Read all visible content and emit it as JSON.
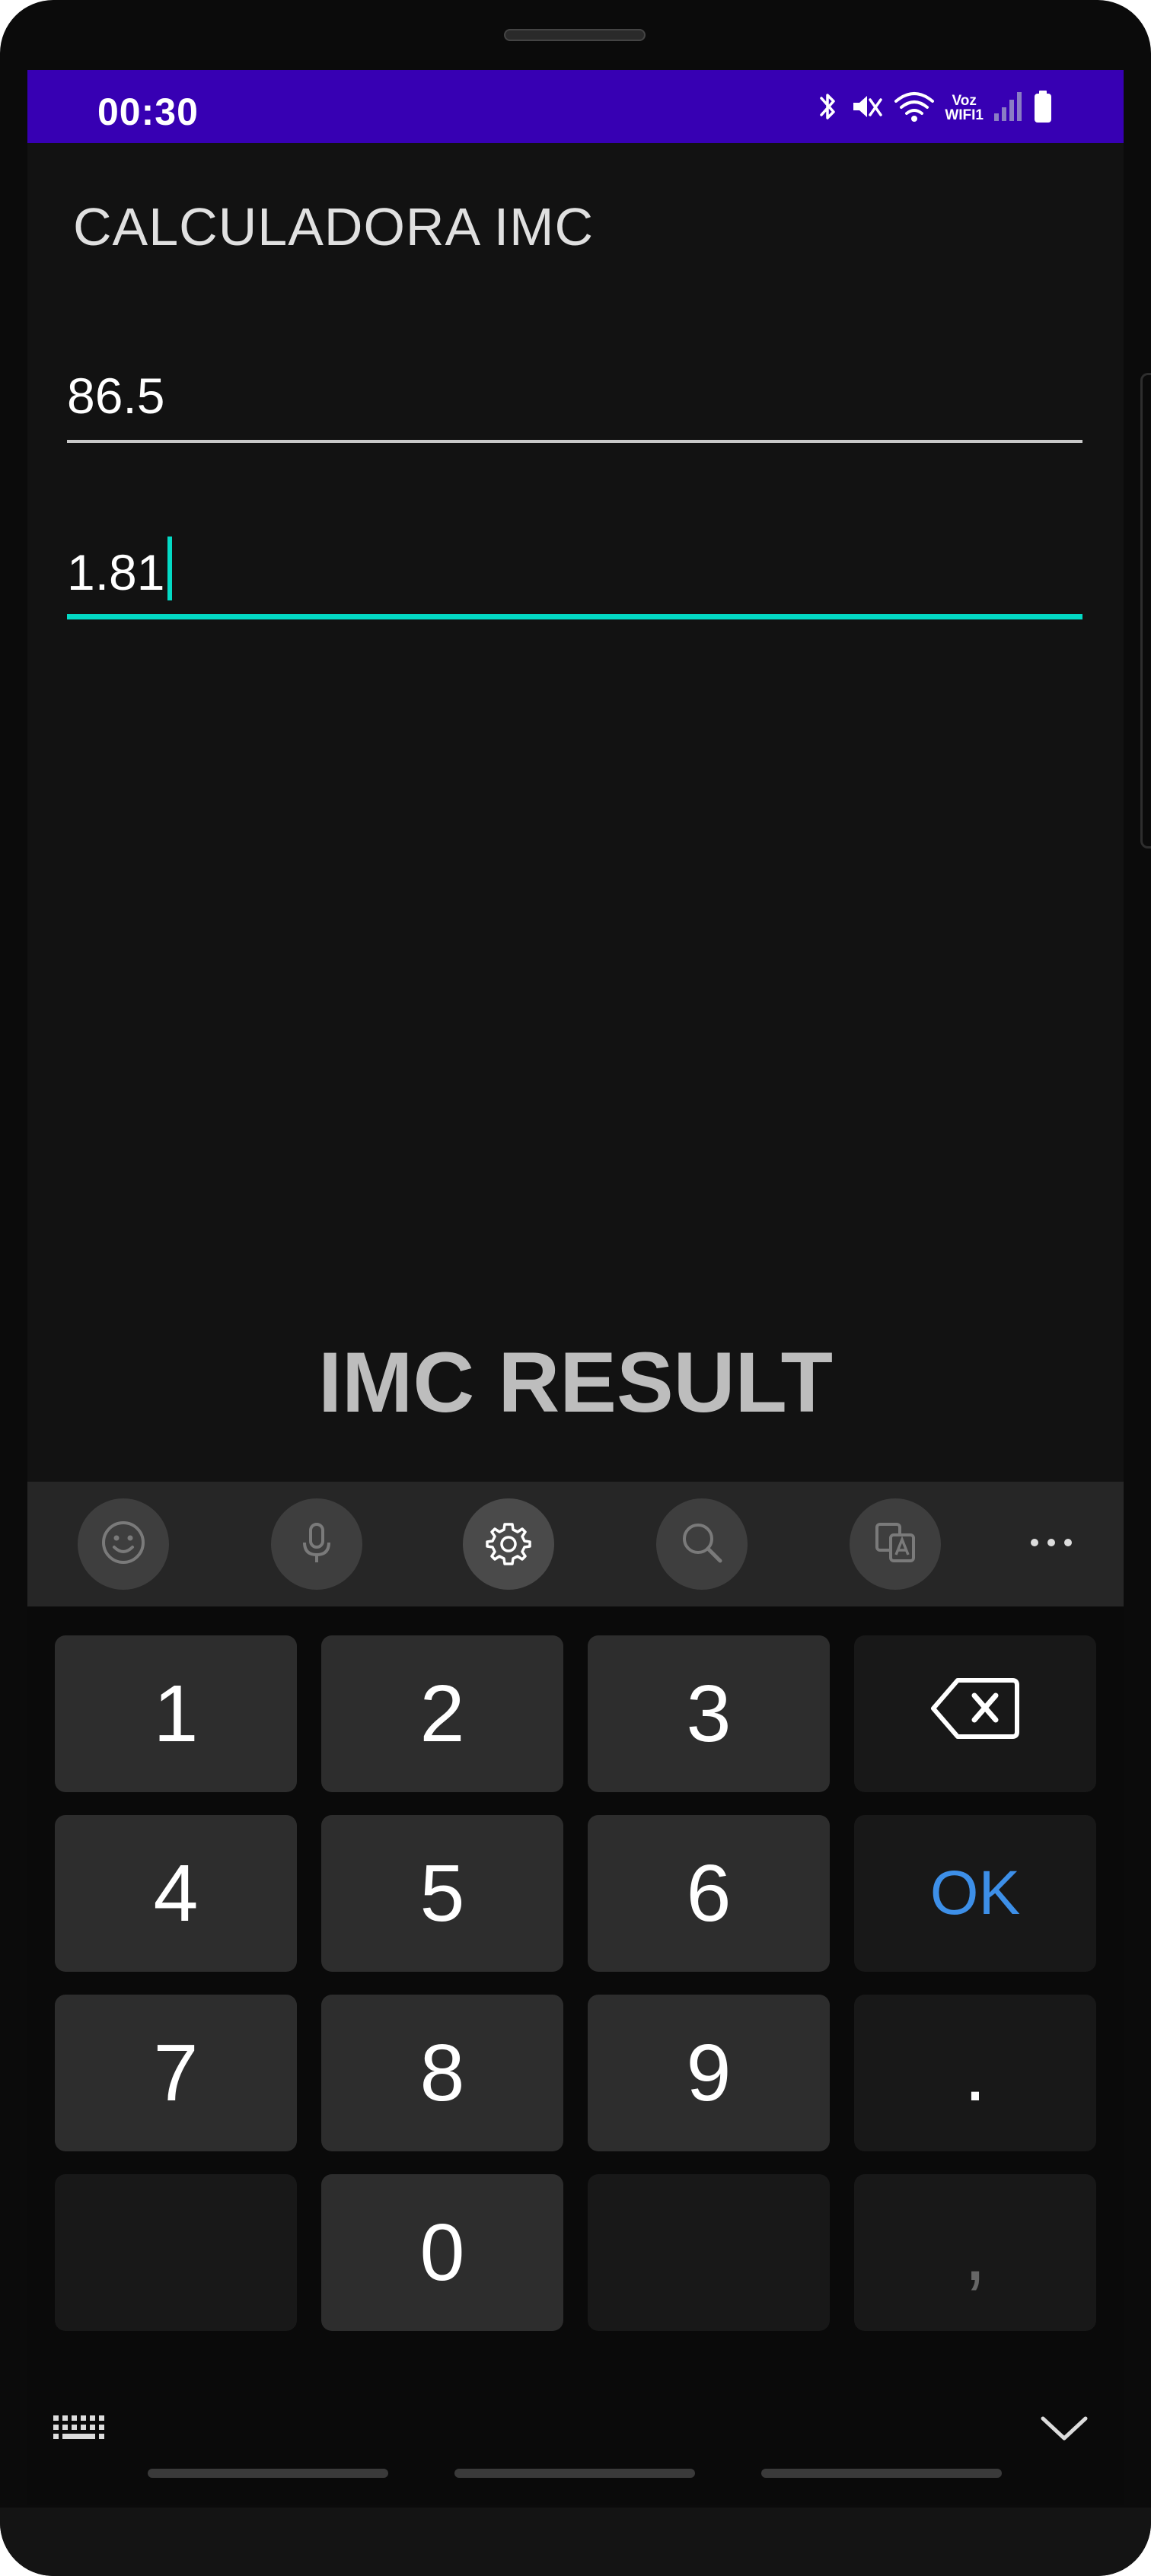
{
  "status_bar": {
    "time": "00:30",
    "network_label_top": "Voz",
    "network_label_bottom": "WIFI1",
    "color": "#3700b3"
  },
  "app": {
    "title": "CALCULADORA IMC"
  },
  "fields": {
    "weight_value": "86.5",
    "height_value": "1.81",
    "focus_color": "#03dac5"
  },
  "result_text": "IMC RESULT",
  "keyboard": {
    "toolbar": [
      "emoji-icon",
      "microphone-icon",
      "settings-icon",
      "search-icon",
      "translate-icon",
      "more-icon"
    ],
    "keys": {
      "k1": "1",
      "k2": "2",
      "k3": "3",
      "k4": "4",
      "k5": "5",
      "k6": "6",
      "k7": "7",
      "k8": "8",
      "k9": "9",
      "k0": "0",
      "ok": "OK",
      "dot": ".",
      "comma": ","
    },
    "ok_color": "#3d8fe8"
  }
}
